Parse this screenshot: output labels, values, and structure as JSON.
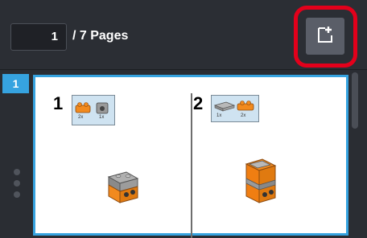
{
  "toolbar": {
    "current_page": "1",
    "page_total_label": "/ 7 Pages",
    "add_page_icon": "add-page-icon"
  },
  "pages": [
    {
      "badge": "1",
      "steps": [
        {
          "number": "1",
          "parts": [
            "2x",
            "1x"
          ]
        },
        {
          "number": "2",
          "parts": [
            "1x",
            "2x"
          ]
        }
      ]
    }
  ],
  "colors": {
    "accent": "#36a3e0",
    "highlight": "#e3001b",
    "lego_orange": "#f28a1e",
    "lego_gray": "#9a9a9a"
  }
}
